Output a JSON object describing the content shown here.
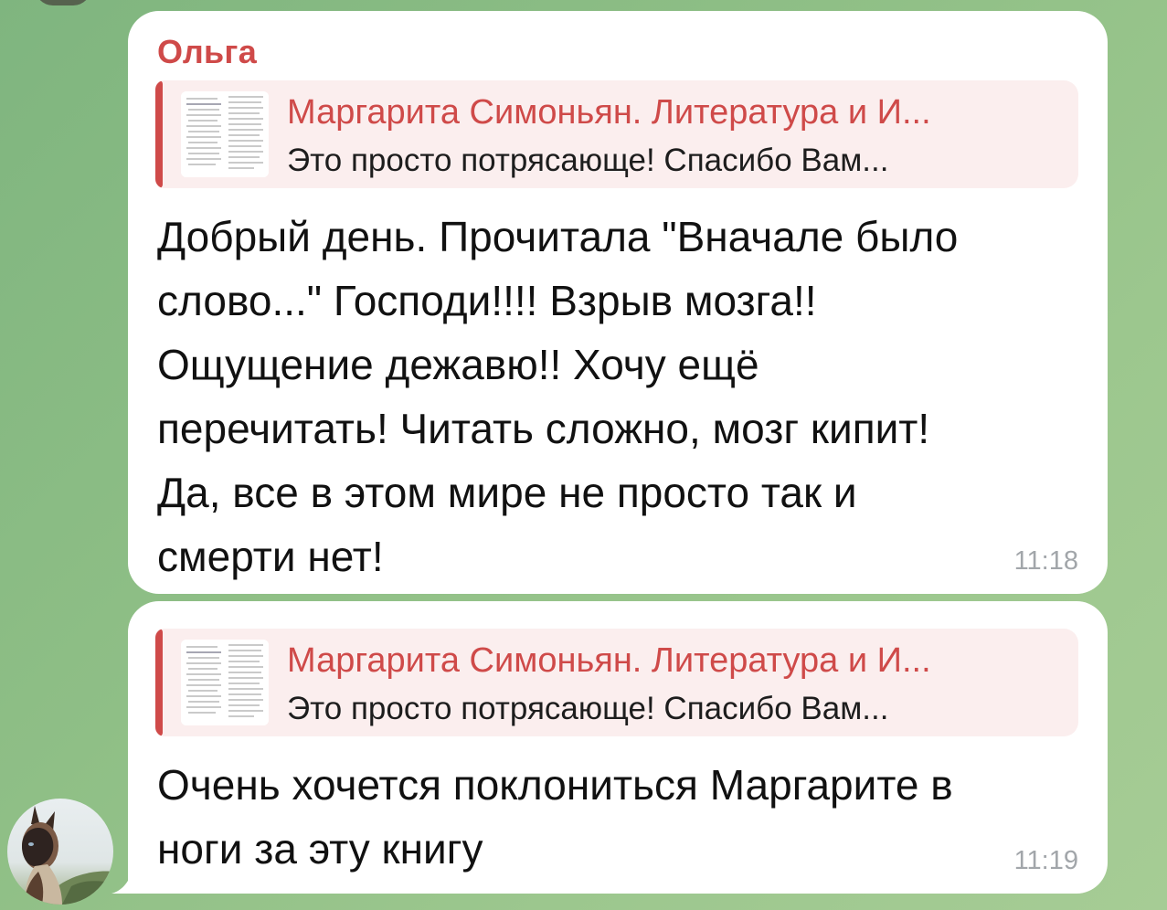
{
  "messages": [
    {
      "sender": "Ольга",
      "reply": {
        "title": "Маргарита Симоньян. Литература и И...",
        "text": "Это просто потрясающе! Спасибо Вам..."
      },
      "lines": [
        "Добрый день. Прочитала \"Вначале было",
        "слово...\" Господи!!!! Взрыв мозга!!",
        "Ощущение дежавю!! Хочу ещё",
        "перечитать! Читать сложно, мозг кипит!",
        "Да, все в этом мире не просто так и",
        "смерти нет!"
      ],
      "time": "11:18"
    },
    {
      "reply": {
        "title": "Маргарита Симоньян. Литература и И...",
        "text": "Это просто потрясающе! Спасибо Вам..."
      },
      "lines": [
        "Очень хочется поклониться Маргарите в",
        "ноги за эту книгу"
      ],
      "time": "11:19"
    }
  ],
  "colors": {
    "accent": "#cf4a49",
    "reply_bg": "#fbeeee",
    "bubble": "#ffffff",
    "time": "#a2a6aa",
    "wallpaper": "#8fbf86"
  },
  "icons": {
    "avatar": "cat-photo-avatar",
    "reply_thumb": "document-page-thumbnail"
  }
}
